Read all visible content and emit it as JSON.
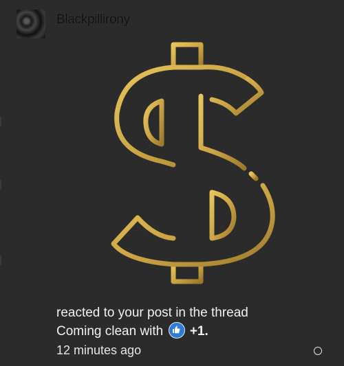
{
  "notification": {
    "username": "Blackpillirony",
    "message_line1": "reacted to your post in the thread",
    "thread_title": "Coming clean with",
    "reaction_icon": "thumbs-up-icon",
    "reaction_count": "+1.",
    "timestamp": "12 minutes ago",
    "accent_color": "#d9b24a",
    "like_color": "#2f7bd6"
  }
}
